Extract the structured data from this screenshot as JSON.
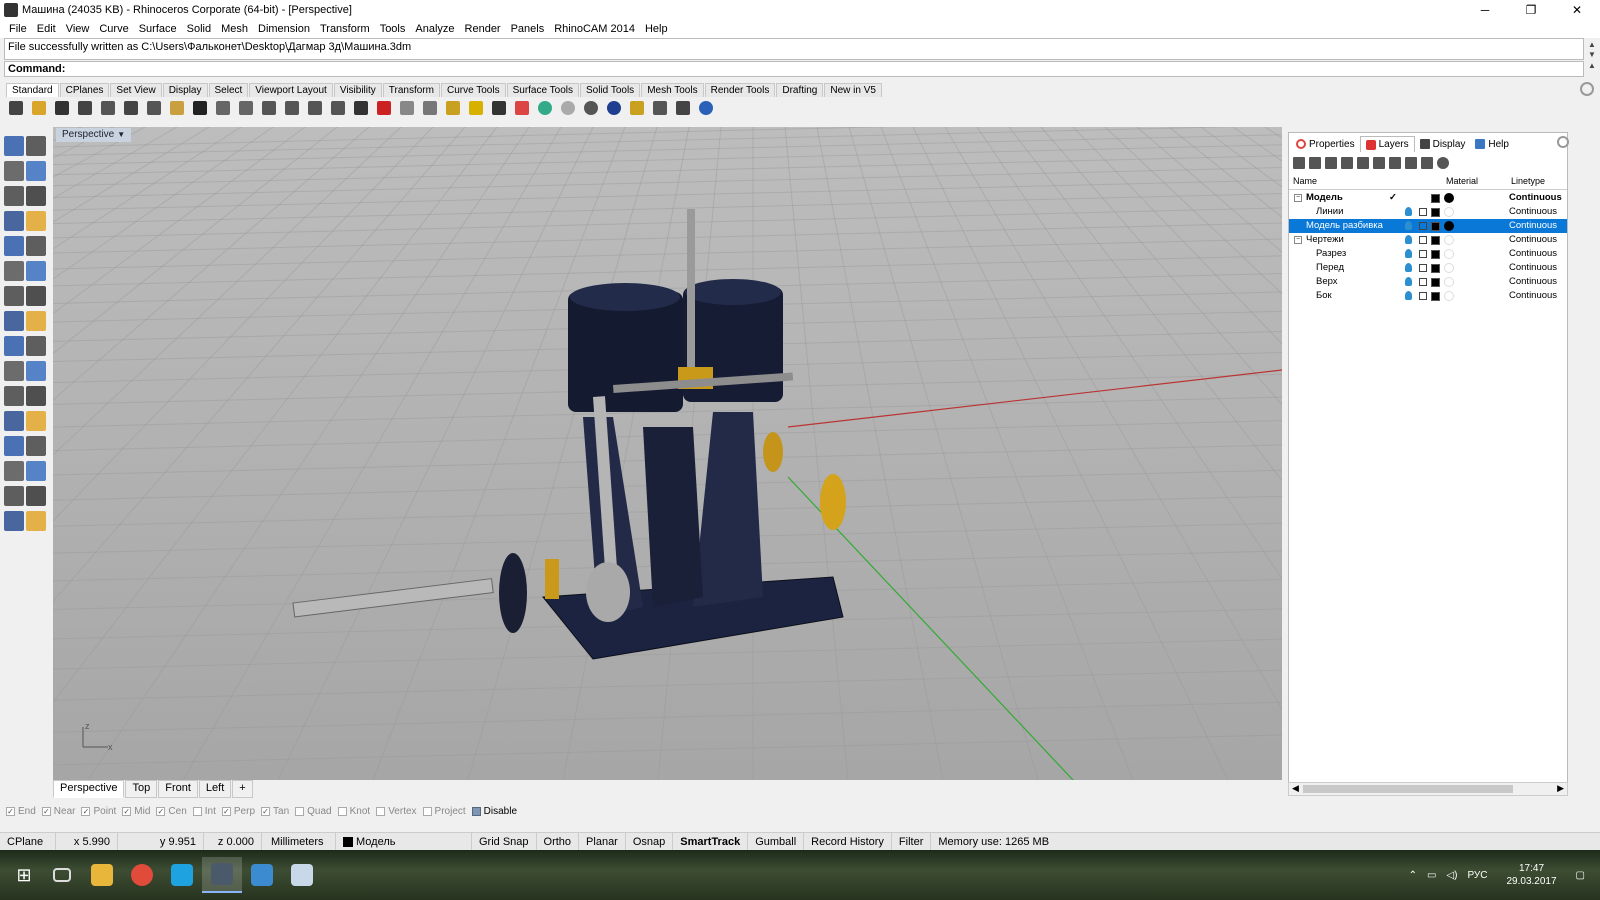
{
  "window": {
    "title": "Машина (24035 KB) - Rhinoceros Corporate (64-bit) - [Perspective]"
  },
  "menu": [
    "File",
    "Edit",
    "View",
    "Curve",
    "Surface",
    "Solid",
    "Mesh",
    "Dimension",
    "Transform",
    "Tools",
    "Analyze",
    "Render",
    "Panels",
    "RhinoCAM 2014",
    "Help"
  ],
  "history": {
    "message": "File successfully written as C:\\Users\\Фальконет\\Desktop\\Дагмар 3д\\Машина.3dm"
  },
  "command": {
    "label": "Command:"
  },
  "toolbar_tabs": [
    "Standard",
    "CPlanes",
    "Set View",
    "Display",
    "Select",
    "Viewport Layout",
    "Visibility",
    "Transform",
    "Curve Tools",
    "Surface Tools",
    "Solid Tools",
    "Mesh Tools",
    "Render Tools",
    "Drafting",
    "New in V5"
  ],
  "toolbar_icons": [
    "new-file-icon",
    "open-file-icon",
    "save-icon",
    "print-icon",
    "import-icon",
    "cut-icon",
    "copy-icon",
    "paste-icon",
    "undo-icon",
    "pan-icon",
    "rotate-view-icon",
    "zoom-icon",
    "zoom-window-icon",
    "zoom-extents-icon",
    "zoom-selected-icon",
    "grid-icon",
    "car-icon",
    "hide-icon",
    "center-icon",
    "points-icon",
    "light-icon",
    "lock-icon",
    "layers-icon",
    "color-icon",
    "render-sphere-icon",
    "shaded-sphere-icon",
    "rendered-sphere-icon",
    "dimension-icon",
    "options-gear-icon",
    "osnap-icon",
    "help-icon"
  ],
  "viewport": {
    "label": "Perspective",
    "axis_x": "x",
    "axis_z": "z"
  },
  "viewport_tabs": [
    "Perspective",
    "Top",
    "Front",
    "Left",
    "+"
  ],
  "osnap": [
    {
      "label": "End",
      "checked": true
    },
    {
      "label": "Near",
      "checked": true
    },
    {
      "label": "Point",
      "checked": true
    },
    {
      "label": "Mid",
      "checked": true
    },
    {
      "label": "Cen",
      "checked": true
    },
    {
      "label": "Int",
      "checked": false
    },
    {
      "label": "Perp",
      "checked": true
    },
    {
      "label": "Tan",
      "checked": true
    },
    {
      "label": "Quad",
      "checked": false
    },
    {
      "label": "Knot",
      "checked": false
    },
    {
      "label": "Vertex",
      "checked": false
    },
    {
      "label": "Project",
      "checked": false
    },
    {
      "label": "Disable",
      "checked": false
    }
  ],
  "status": {
    "cplane": "CPlane",
    "x": "x 5.990",
    "y": "y 9.951",
    "z": "z 0.000",
    "units": "Millimeters",
    "layer": "Модель",
    "grid_snap": "Grid Snap",
    "ortho": "Ortho",
    "planar": "Planar",
    "osnap": "Osnap",
    "smarttrack": "SmartTrack",
    "gumball": "Gumball",
    "record_history": "Record History",
    "filter": "Filter",
    "memory": "Memory use: 1265 MB"
  },
  "panel": {
    "tabs": [
      "Properties",
      "Layers",
      "Display",
      "Help"
    ],
    "columns": {
      "name": "Name",
      "material": "Material",
      "linetype": "Linetype"
    },
    "layers": [
      {
        "name": "Модель",
        "level": 0,
        "expand": "−",
        "current": true,
        "linetype": "Continuous",
        "selected": false,
        "material": "#000000"
      },
      {
        "name": "Линии",
        "level": 1,
        "expand": "",
        "current": false,
        "linetype": "Continuous",
        "selected": false,
        "material": ""
      },
      {
        "name": "Модель разбивка",
        "level": 0,
        "expand": "",
        "current": false,
        "linetype": "Continuous",
        "selected": true,
        "material": "#000000"
      },
      {
        "name": "Чертежи",
        "level": 0,
        "expand": "−",
        "current": false,
        "linetype": "Continuous",
        "selected": false,
        "material": ""
      },
      {
        "name": "Разрез",
        "level": 1,
        "expand": "",
        "current": false,
        "linetype": "Continuous",
        "selected": false,
        "material": ""
      },
      {
        "name": "Перед",
        "level": 1,
        "expand": "",
        "current": false,
        "linetype": "Continuous",
        "selected": false,
        "material": ""
      },
      {
        "name": "Верх",
        "level": 1,
        "expand": "",
        "current": false,
        "linetype": "Continuous",
        "selected": false,
        "material": ""
      },
      {
        "name": "Бок",
        "level": 1,
        "expand": "",
        "current": false,
        "linetype": "Continuous",
        "selected": false,
        "material": ""
      }
    ]
  },
  "taskbar": {
    "apps": [
      "file-explorer-icon",
      "chrome-icon",
      "skype-icon",
      "rhino-icon",
      "window-icon",
      "notepad-icon"
    ],
    "language": "РУС",
    "time": "17:47",
    "date": "29.03.2017"
  }
}
